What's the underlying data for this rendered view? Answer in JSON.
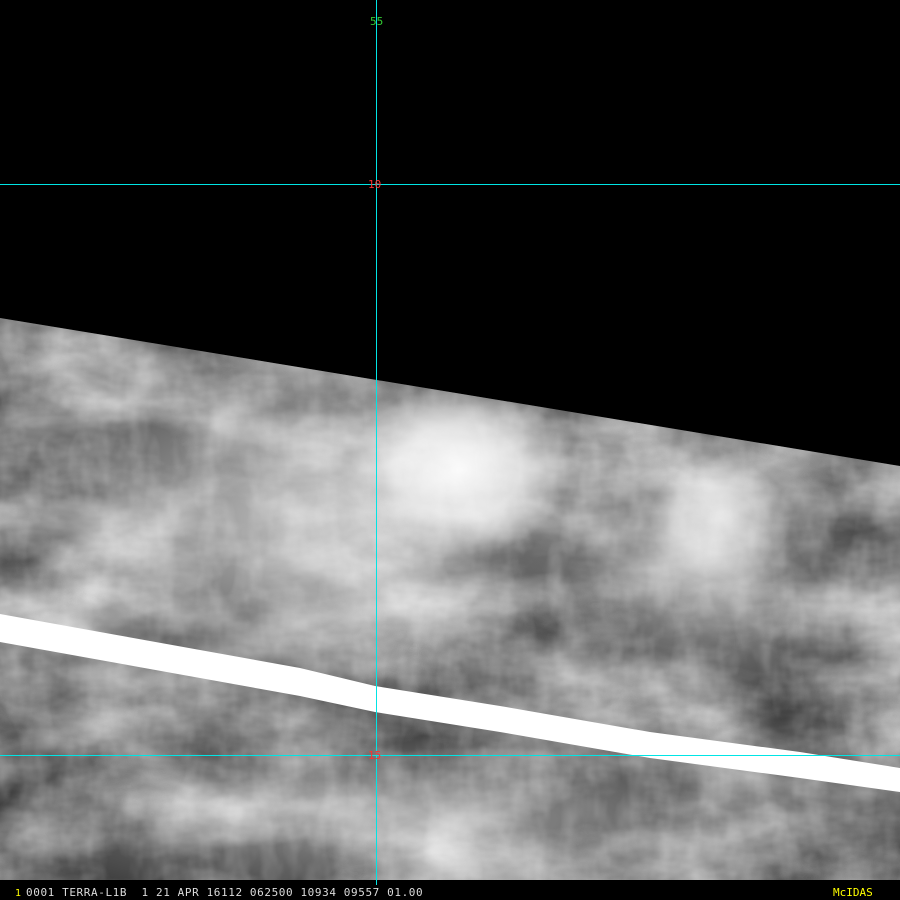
{
  "grid_labels": {
    "longitude_top": "55",
    "latitude_upper": "10",
    "latitude_lower": "15"
  },
  "status_bar": {
    "frame_number": "1",
    "info": "0001 TERRA-L1B  1 21 APR 16112 062500 10934 09557 01.00",
    "brand": "McIDAS"
  },
  "colors": {
    "grid": "#00e5e5",
    "longitude_label": "#33cc33",
    "latitude_label": "#ff3030",
    "status_text": "#dcdcdc",
    "brand": "#ffff00",
    "no_data": "#000000",
    "swath_gap": "#ffffff"
  }
}
